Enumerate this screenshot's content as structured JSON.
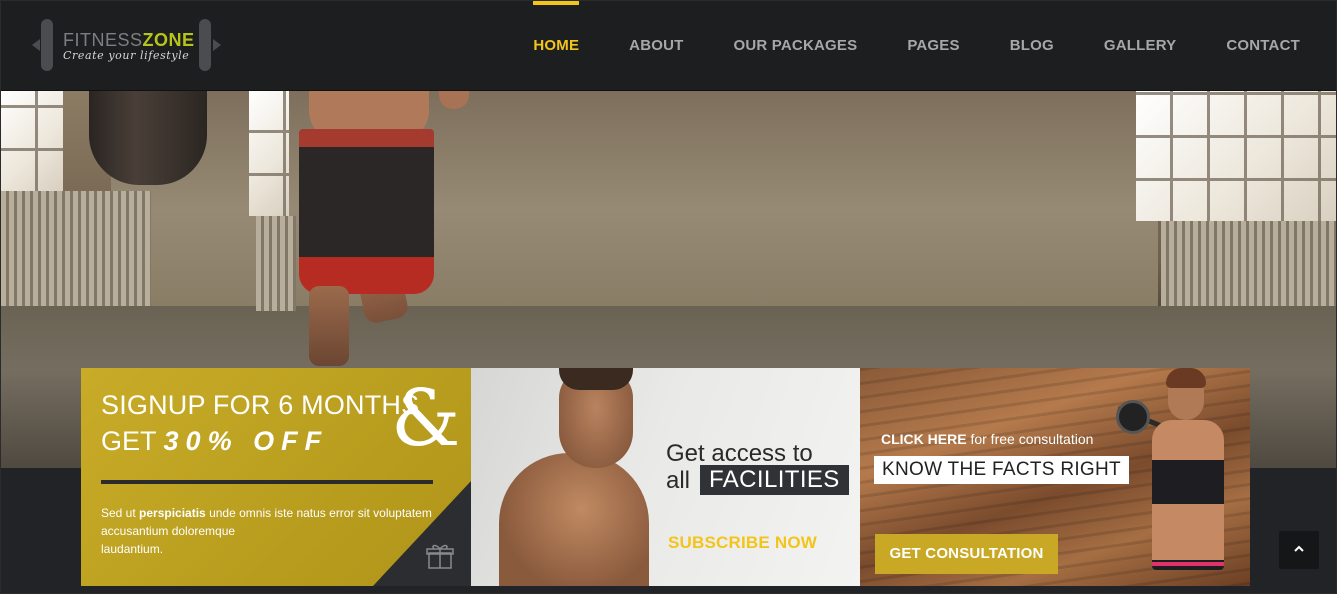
{
  "logo": {
    "name_part1": "FITNESS",
    "name_part2": "ZONE",
    "tagline": "Create your lifestyle"
  },
  "nav": {
    "items": [
      {
        "label": "HOME",
        "active": true
      },
      {
        "label": "ABOUT",
        "active": false
      },
      {
        "label": "OUR PACKAGES",
        "active": false
      },
      {
        "label": "PAGES",
        "active": false
      },
      {
        "label": "BLOG",
        "active": false
      },
      {
        "label": "GALLERY",
        "active": false
      },
      {
        "label": "CONTACT",
        "active": false
      }
    ]
  },
  "promo_signup": {
    "line1": "SIGNUP FOR 6 MONTHS",
    "line2_prefix": "GET",
    "line2_highlight": "30% OFF",
    "ampersand": "&",
    "body_prefix": "Sed ut ",
    "body_bold": "perspiciatis",
    "body_suffix": " unde omnis iste natus error sit voluptatem accusantium doloremque",
    "body_line3": "laudantium.",
    "icon": "gift-icon"
  },
  "promo_facilities": {
    "line1": "Get access to",
    "line2_prefix": "all",
    "line2_highlight": "FACILITIES",
    "cta": "SUBSCRIBE NOW"
  },
  "promo_consultation": {
    "click_bold": "CLICK HERE",
    "click_rest": " for free consultation",
    "headline": "KNOW THE FACTS RIGHT",
    "button": "GET CONSULTATION"
  },
  "back_to_top": {
    "icon": "chevron-up-icon"
  },
  "colors": {
    "accent_yellow": "#f3c51b",
    "brand_green": "#b7c41a",
    "promo_gold": "#c8ac28",
    "header_bg": "#1d1e20"
  }
}
